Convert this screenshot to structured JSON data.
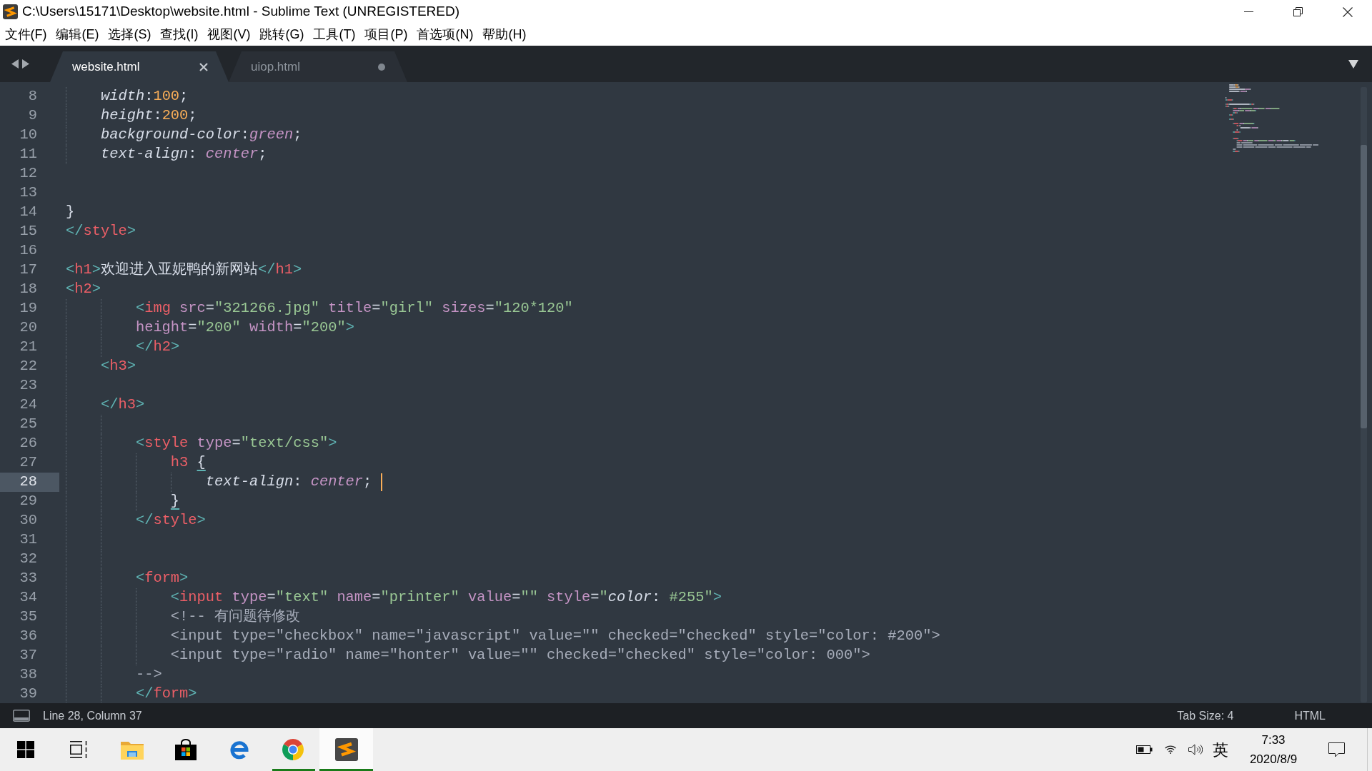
{
  "window": {
    "title": "C:\\Users\\15171\\Desktop\\website.html - Sublime Text (UNREGISTERED)"
  },
  "menu": [
    "文件(F)",
    "编辑(E)",
    "选择(S)",
    "查找(I)",
    "视图(V)",
    "跳转(G)",
    "工具(T)",
    "项目(P)",
    "首选项(N)",
    "帮助(H)"
  ],
  "tabs": [
    {
      "label": "website.html",
      "selected": true,
      "modified": false
    },
    {
      "label": "uiop.html",
      "selected": false,
      "modified": true
    }
  ],
  "editor": {
    "lines": [
      {
        "number": "8",
        "current": false,
        "tokens": [
          {
            "kind": "prop",
            "text": "    width"
          },
          {
            "kind": "punct",
            "text": ":"
          },
          {
            "kind": "number",
            "text": "100"
          },
          {
            "kind": "punct",
            "text": ";"
          }
        ]
      },
      {
        "number": "9",
        "current": false,
        "tokens": [
          {
            "kind": "prop",
            "text": "    height"
          },
          {
            "kind": "punct",
            "text": ":"
          },
          {
            "kind": "number",
            "text": "200"
          },
          {
            "kind": "punct",
            "text": ";"
          }
        ]
      },
      {
        "number": "10",
        "current": false,
        "tokens": [
          {
            "kind": "prop",
            "text": "    background-color"
          },
          {
            "kind": "punct",
            "text": ":"
          },
          {
            "kind": "value",
            "text": "green"
          },
          {
            "kind": "punct",
            "text": ";"
          }
        ]
      },
      {
        "number": "11",
        "current": false,
        "tokens": [
          {
            "kind": "prop",
            "text": "    text-align"
          },
          {
            "kind": "punct",
            "text": ":"
          },
          {
            "kind": "value",
            "text": " center"
          },
          {
            "kind": "punct",
            "text": ";"
          }
        ]
      },
      {
        "number": "12",
        "current": false
      },
      {
        "number": "13",
        "current": false
      },
      {
        "number": "14",
        "current": false,
        "tokens": [
          {
            "kind": "punct",
            "text": "}"
          }
        ]
      },
      {
        "number": "15",
        "current": false,
        "tokens": [
          {
            "kind": "tagp",
            "text": "</"
          },
          {
            "kind": "tag",
            "text": "style"
          },
          {
            "kind": "tagp",
            "text": ">"
          }
        ]
      },
      {
        "number": "16",
        "current": false
      },
      {
        "number": "17",
        "current": false,
        "tokens": [
          {
            "kind": "tagp",
            "text": "<"
          },
          {
            "kind": "tag",
            "text": "h1"
          },
          {
            "kind": "tagp",
            "text": ">"
          },
          {
            "kind": "text",
            "text": "欢迎进入亚妮鸭的新网站"
          },
          {
            "kind": "tagp",
            "text": "</"
          },
          {
            "kind": "tag",
            "text": "h1"
          },
          {
            "kind": "tagp",
            "text": ">"
          }
        ]
      },
      {
        "number": "18",
        "current": false,
        "tokens": [
          {
            "kind": "tagp",
            "text": "<"
          },
          {
            "kind": "tag",
            "text": "h2"
          },
          {
            "kind": "tagp",
            "text": ">"
          }
        ]
      },
      {
        "number": "19",
        "current": false,
        "tokens": [
          {
            "kind": "tagp",
            "text": "        <"
          },
          {
            "kind": "tag",
            "text": "img"
          },
          {
            "kind": "attr",
            "text": " src"
          },
          {
            "kind": "punct",
            "text": "="
          },
          {
            "kind": "string",
            "text": "\"321266.jpg\""
          },
          {
            "kind": "attr",
            "text": " title"
          },
          {
            "kind": "punct",
            "text": "="
          },
          {
            "kind": "string",
            "text": "\"girl\""
          },
          {
            "kind": "attr",
            "text": " sizes"
          },
          {
            "kind": "punct",
            "text": "="
          },
          {
            "kind": "string",
            "text": "\"120*120\""
          }
        ]
      },
      {
        "number": "20",
        "current": false,
        "tokens": [
          {
            "kind": "attr",
            "text": "        height"
          },
          {
            "kind": "punct",
            "text": "="
          },
          {
            "kind": "string",
            "text": "\"200\""
          },
          {
            "kind": "attr",
            "text": " width"
          },
          {
            "kind": "punct",
            "text": "="
          },
          {
            "kind": "string",
            "text": "\"200\""
          },
          {
            "kind": "tagp",
            "text": ">"
          }
        ]
      },
      {
        "number": "21",
        "current": false,
        "tokens": [
          {
            "kind": "tagp",
            "text": "        </"
          },
          {
            "kind": "tag",
            "text": "h2"
          },
          {
            "kind": "tagp",
            "text": ">"
          }
        ]
      },
      {
        "number": "22",
        "current": false,
        "tokens": [
          {
            "kind": "tagp",
            "text": "    <"
          },
          {
            "kind": "tag",
            "text": "h3"
          },
          {
            "kind": "tagp",
            "text": ">"
          }
        ]
      },
      {
        "number": "23",
        "current": false
      },
      {
        "number": "24",
        "current": false,
        "tokens": [
          {
            "kind": "tagp",
            "text": "    </"
          },
          {
            "kind": "tag",
            "text": "h3"
          },
          {
            "kind": "tagp",
            "text": ">"
          }
        ]
      },
      {
        "number": "25",
        "current": false
      },
      {
        "number": "26",
        "current": false,
        "tokens": [
          {
            "kind": "tagp",
            "text": "        <"
          },
          {
            "kind": "tag",
            "text": "style"
          },
          {
            "kind": "attr",
            "text": " type"
          },
          {
            "kind": "punct",
            "text": "="
          },
          {
            "kind": "string",
            "text": "\"text/css\""
          },
          {
            "kind": "tagp",
            "text": ">"
          }
        ]
      },
      {
        "number": "27",
        "current": false,
        "tokens": [
          {
            "kind": "tag",
            "text": "            h3 "
          },
          {
            "kind": "match",
            "text": "{"
          }
        ]
      },
      {
        "number": "28",
        "current": true,
        "tokens": [
          {
            "kind": "prop",
            "text": "                text-align"
          },
          {
            "kind": "punct",
            "text": ":"
          },
          {
            "kind": "value",
            "text": " center"
          },
          {
            "kind": "punct",
            "text": "; "
          }
        ]
      },
      {
        "number": "29",
        "current": false,
        "tokens": [
          {
            "kind": "match",
            "text": "            }"
          }
        ]
      },
      {
        "number": "30",
        "current": false,
        "tokens": [
          {
            "kind": "tagp",
            "text": "        </"
          },
          {
            "kind": "tag",
            "text": "style"
          },
          {
            "kind": "tagp",
            "text": ">"
          }
        ]
      },
      {
        "number": "31",
        "current": false
      },
      {
        "number": "32",
        "current": false
      },
      {
        "number": "33",
        "current": false,
        "tokens": [
          {
            "kind": "tagp",
            "text": "        <"
          },
          {
            "kind": "tag",
            "text": "form"
          },
          {
            "kind": "tagp",
            "text": ">"
          }
        ]
      },
      {
        "number": "34",
        "current": false,
        "tokens": [
          {
            "kind": "tagp",
            "text": "            <"
          },
          {
            "kind": "tag",
            "text": "input"
          },
          {
            "kind": "attr",
            "text": " type"
          },
          {
            "kind": "punct",
            "text": "="
          },
          {
            "kind": "string",
            "text": "\"text\""
          },
          {
            "kind": "attr",
            "text": " name"
          },
          {
            "kind": "punct",
            "text": "="
          },
          {
            "kind": "string",
            "text": "\"printer\""
          },
          {
            "kind": "attr",
            "text": " value"
          },
          {
            "kind": "punct",
            "text": "="
          },
          {
            "kind": "string",
            "text": "\"\""
          },
          {
            "kind": "attr",
            "text": " style"
          },
          {
            "kind": "punct",
            "text": "="
          },
          {
            "kind": "string",
            "text": "\""
          },
          {
            "kind": "prop",
            "text": "color"
          },
          {
            "kind": "punct",
            "text": ":"
          },
          {
            "kind": "string",
            "text": " #255\""
          },
          {
            "kind": "tagp",
            "text": ">"
          }
        ]
      },
      {
        "number": "35",
        "current": false,
        "tokens": [
          {
            "kind": "comment",
            "text": "            <!-- 有问题待修改"
          }
        ]
      },
      {
        "number": "36",
        "current": false,
        "tokens": [
          {
            "kind": "comment",
            "text": "            <input type=\"checkbox\" name=\"javascript\" value=\"\" checked=\"checked\" style=\"color: #200\">"
          }
        ]
      },
      {
        "number": "37",
        "current": false,
        "tokens": [
          {
            "kind": "comment",
            "text": "            <input type=\"radio\" name=\"honter\" value=\"\" checked=\"checked\" style=\"color: 000\">"
          }
        ]
      },
      {
        "number": "38",
        "current": false,
        "tokens": [
          {
            "kind": "comment",
            "text": "        -->"
          }
        ]
      },
      {
        "number": "39",
        "current": false,
        "tokens": [
          {
            "kind": "tagp",
            "text": "        </"
          },
          {
            "kind": "tag",
            "text": "form"
          },
          {
            "kind": "tagp",
            "text": ">"
          }
        ]
      }
    ]
  },
  "status_bar": {
    "position": "Line 28, Column 37",
    "tab_size": "Tab Size: 4",
    "syntax": "HTML"
  },
  "taskbar": {
    "apps": [
      {
        "kind": "start",
        "running": false,
        "selected": false
      },
      {
        "kind": "task-view",
        "running": false,
        "selected": false
      },
      {
        "kind": "explorer",
        "running": false,
        "selected": false
      },
      {
        "kind": "store",
        "running": false,
        "selected": false
      },
      {
        "kind": "edge",
        "running": false,
        "selected": false
      },
      {
        "kind": "chrome",
        "running": true,
        "selected": false
      },
      {
        "kind": "sublime",
        "running": true,
        "selected": true
      }
    ],
    "input_method": "英",
    "time": "7:33",
    "date": "2020/8/9"
  }
}
